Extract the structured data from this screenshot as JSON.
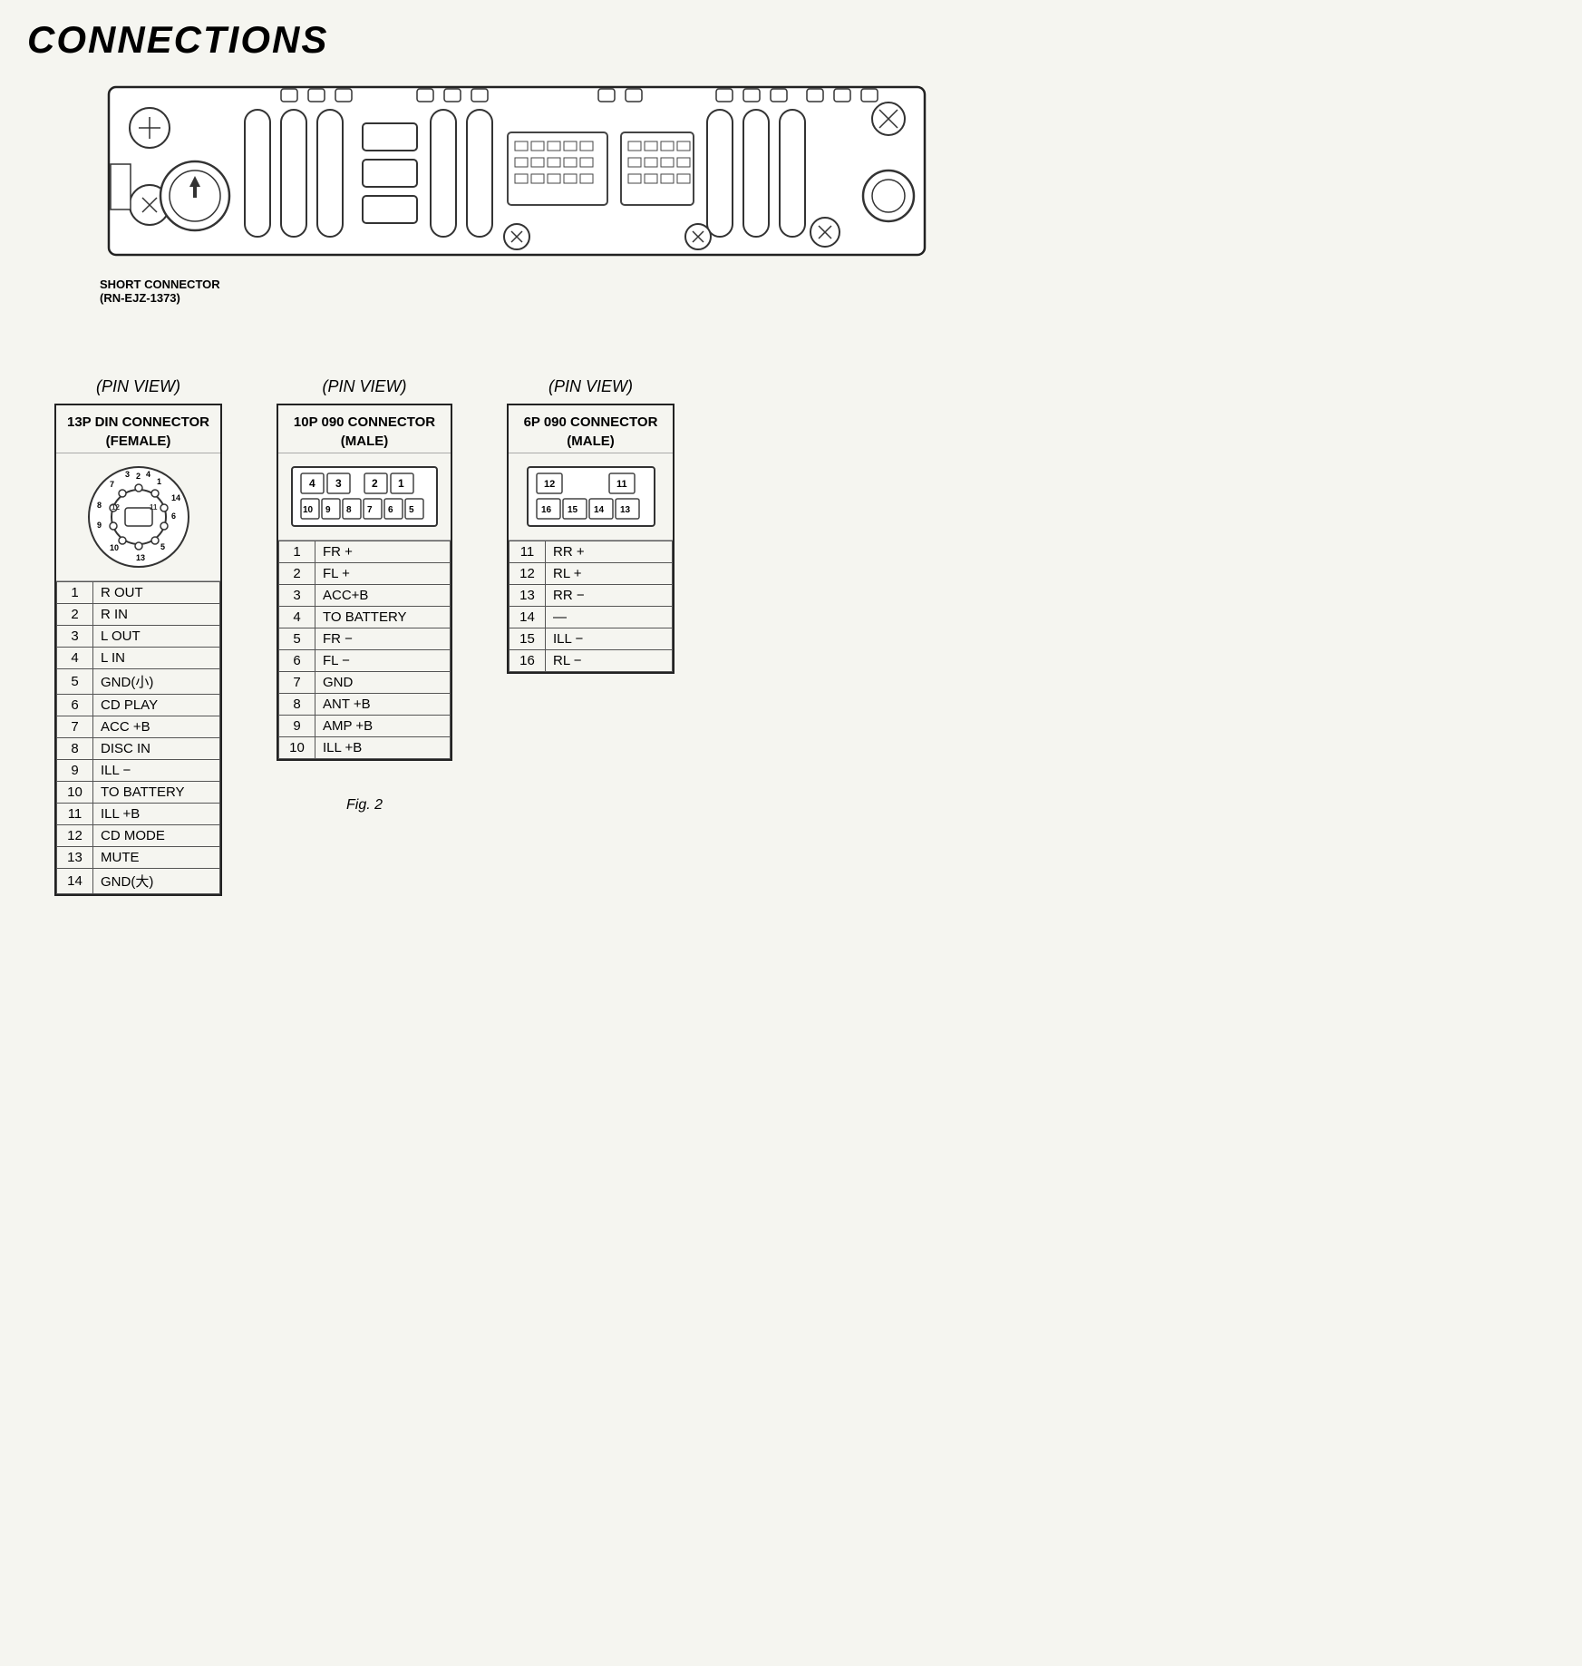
{
  "page": {
    "title": "CONNECTIONS",
    "short_connector_label_line1": "SHORT CONNECTOR",
    "short_connector_label_line2": "(RN-EJZ-1373)",
    "fig_label": "Fig. 2"
  },
  "connectors": [
    {
      "id": "13p-din",
      "pin_view": "(PIN  VIEW)",
      "title_line1": "13P DIN CONNECTOR",
      "title_line2": "(FEMALE)",
      "type": "circle",
      "pins": [
        {
          "num": "1",
          "label": "R OUT"
        },
        {
          "num": "2",
          "label": "R IN"
        },
        {
          "num": "3",
          "label": "L OUT"
        },
        {
          "num": "4",
          "label": "L IN"
        },
        {
          "num": "5",
          "label": "GND(小)"
        },
        {
          "num": "6",
          "label": "CD PLAY"
        },
        {
          "num": "7",
          "label": "ACC +B"
        },
        {
          "num": "8",
          "label": "DISC IN"
        },
        {
          "num": "9",
          "label": "ILL −"
        },
        {
          "num": "10",
          "label": "TO BATTERY"
        },
        {
          "num": "11",
          "label": "ILL +B"
        },
        {
          "num": "12",
          "label": "CD MODE"
        },
        {
          "num": "13",
          "label": "MUTE"
        },
        {
          "num": "14",
          "label": "GND(大)"
        }
      ]
    },
    {
      "id": "10p-090",
      "pin_view": "(PIN  VIEW)",
      "title_line1": "10P 090 CONNECTOR",
      "title_line2": "(MALE)",
      "type": "grid10",
      "grid_cells": [
        "4",
        "3",
        "",
        "2",
        "1",
        "10",
        "9",
        "8",
        "7",
        "6",
        "5"
      ],
      "pins": [
        {
          "num": "1",
          "label": "FR +"
        },
        {
          "num": "2",
          "label": "FL +"
        },
        {
          "num": "3",
          "label": "ACC+B"
        },
        {
          "num": "4",
          "label": "TO BATTERY"
        },
        {
          "num": "5",
          "label": "FR −"
        },
        {
          "num": "6",
          "label": "FL −"
        },
        {
          "num": "7",
          "label": "GND"
        },
        {
          "num": "8",
          "label": "ANT +B"
        },
        {
          "num": "9",
          "label": "AMP +B"
        },
        {
          "num": "10",
          "label": "ILL +B"
        }
      ]
    },
    {
      "id": "6p-090",
      "pin_view": "(PIN  VIEW)",
      "title_line1": "6P 090 CONNECTOR",
      "title_line2": "(MALE)",
      "type": "grid6",
      "grid_cells_top": [
        "12",
        "",
        "11"
      ],
      "grid_cells_bot": [
        "16",
        "15",
        "14",
        "13"
      ],
      "pins": [
        {
          "num": "11",
          "label": "RR +"
        },
        {
          "num": "12",
          "label": "RL +"
        },
        {
          "num": "13",
          "label": "RR −"
        },
        {
          "num": "14",
          "label": "—"
        },
        {
          "num": "15",
          "label": "ILL −"
        },
        {
          "num": "16",
          "label": "RL −"
        }
      ]
    }
  ]
}
